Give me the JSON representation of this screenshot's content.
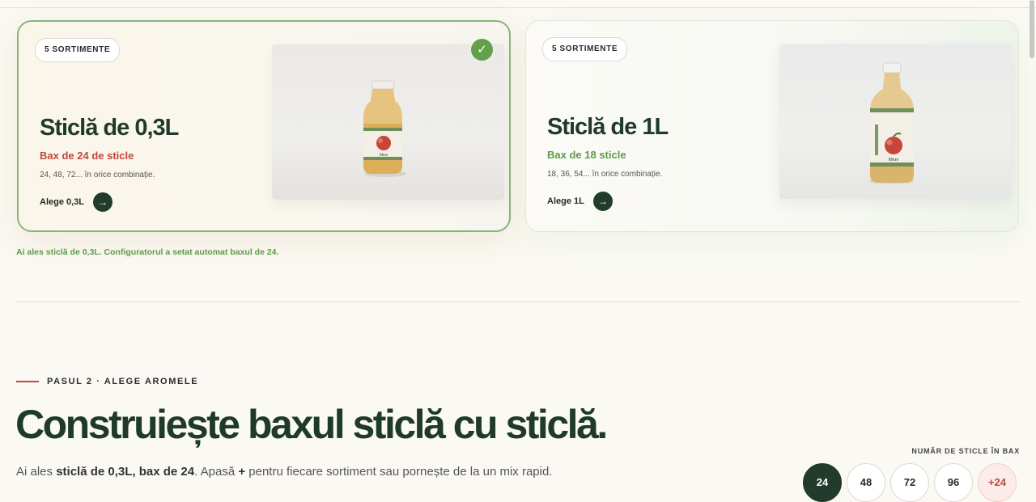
{
  "cards": [
    {
      "badge": "5 SORTIMENTE",
      "title": "Sticlă de 0,3L",
      "subtitle": "Bax de 24 de sticle",
      "note": "24, 48, 72... în orice combinație.",
      "cta": "Alege 0,3L",
      "product_label": "Mere",
      "selected": true
    },
    {
      "badge": "5 SORTIMENTE",
      "title": "Sticlă de 1L",
      "subtitle": "Bax de 18 sticle",
      "note": "18, 36, 54... în orice combinație.",
      "cta": "Alege 1L",
      "product_label": "Mere",
      "selected": false
    }
  ],
  "selection_message": "Ai ales sticlă de 0,3L. Configuratorul a setat automat baxul de 24.",
  "step": {
    "label": "PASUL 2 · ALEGE AROMELE",
    "headline": "Construiește baxul sticlă cu sticlă.",
    "lead_prefix": "Ai ales ",
    "lead_bold": "sticlă de 0,3L, bax de 24",
    "lead_mid": ". Apasă ",
    "lead_plus": "+",
    "lead_suffix": " pentru fiecare sortiment sau pornește de la un mix rapid."
  },
  "bottle_count": {
    "label": "NUMĂR DE STICLE ÎN BAX",
    "options": [
      "24",
      "48",
      "72",
      "96",
      "+24"
    ],
    "selected": "24"
  },
  "icons": {
    "check": "check-icon",
    "arrow": "arrow-right-icon"
  },
  "colors": {
    "dark_green": "#223b2c",
    "accent_red": "#c2473e",
    "accent_green": "#5e9a4a"
  }
}
